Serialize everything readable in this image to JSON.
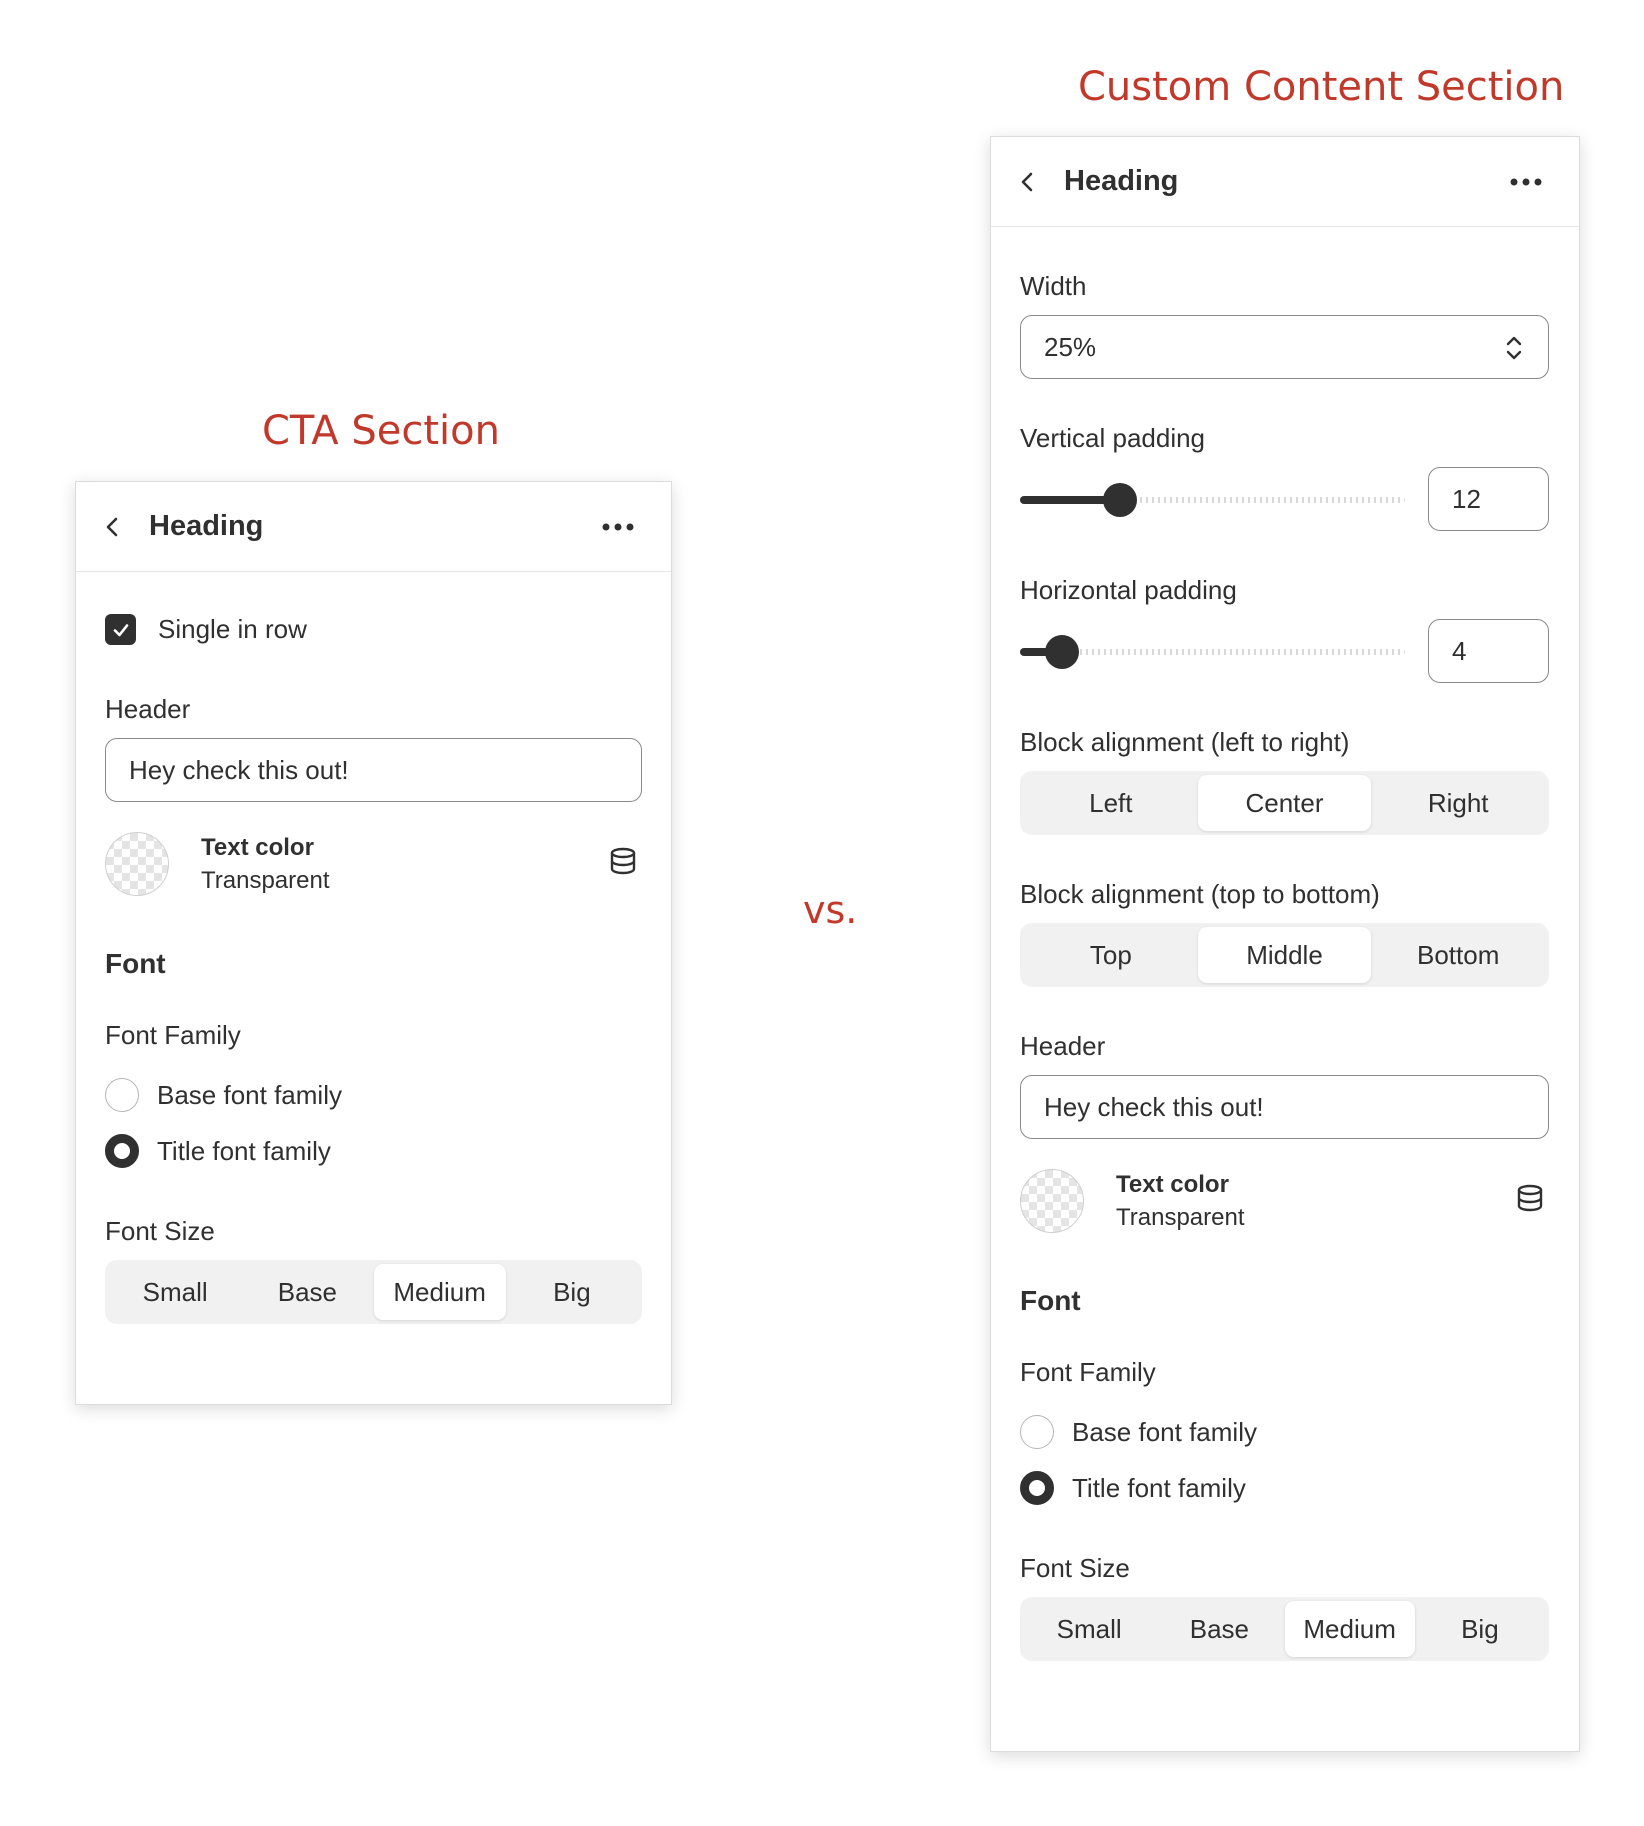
{
  "captions": {
    "cta": "CTA Section",
    "custom": "Custom Content Section",
    "vs": "vs."
  },
  "cta_panel": {
    "header": {
      "title": "Heading",
      "back_icon": "chevron-left-icon",
      "more_icon": "ellipsis-icon"
    },
    "single_in_row": {
      "label": "Single in row",
      "checked": true
    },
    "header_field": {
      "label": "Header",
      "value": "Hey check this out!"
    },
    "text_color": {
      "title": "Text color",
      "value": "Transparent",
      "icon": "database-icon"
    },
    "font": {
      "section_title": "Font",
      "family_label": "Font Family",
      "family_options": [
        {
          "label": "Base font family",
          "selected": false
        },
        {
          "label": "Title font family",
          "selected": true
        }
      ],
      "size_label": "Font Size",
      "size_options": [
        "Small",
        "Base",
        "Medium",
        "Big"
      ],
      "size_selected": "Medium"
    }
  },
  "custom_panel": {
    "header": {
      "title": "Heading",
      "back_icon": "chevron-left-icon",
      "more_icon": "ellipsis-icon"
    },
    "width": {
      "label": "Width",
      "value": "25%"
    },
    "vertical_padding": {
      "label": "Vertical padding",
      "value": "12",
      "fraction": 0.26
    },
    "horizontal_padding": {
      "label": "Horizontal padding",
      "value": "4",
      "fraction": 0.11
    },
    "block_alignment_lr": {
      "label": "Block alignment (left to right)",
      "options": [
        "Left",
        "Center",
        "Right"
      ],
      "selected": "Center"
    },
    "block_alignment_tb": {
      "label": "Block alignment (top to bottom)",
      "options": [
        "Top",
        "Middle",
        "Bottom"
      ],
      "selected": "Middle"
    },
    "header_field": {
      "label": "Header",
      "value": "Hey check this out!"
    },
    "text_color": {
      "title": "Text color",
      "value": "Transparent",
      "icon": "database-icon"
    },
    "font": {
      "section_title": "Font",
      "family_label": "Font Family",
      "family_options": [
        {
          "label": "Base font family",
          "selected": false
        },
        {
          "label": "Title font family",
          "selected": true
        }
      ],
      "size_label": "Font Size",
      "size_options": [
        "Small",
        "Base",
        "Medium",
        "Big"
      ],
      "size_selected": "Medium"
    }
  },
  "colors": {
    "caption": "#c0392b",
    "text": "#303030",
    "segment_bg": "#f1f1f1"
  }
}
